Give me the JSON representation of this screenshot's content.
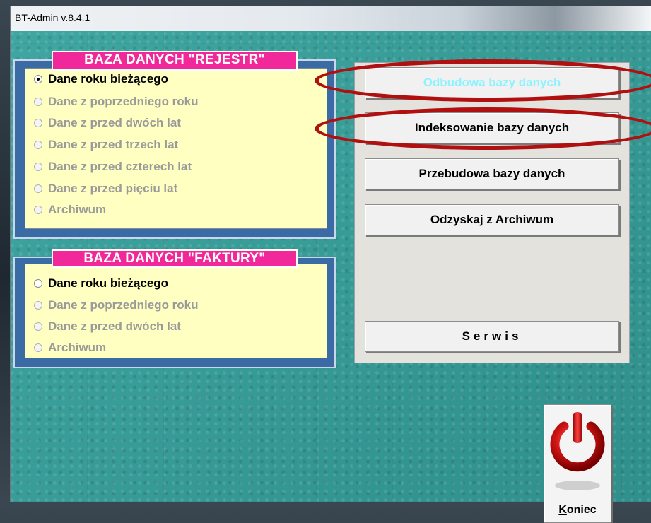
{
  "window": {
    "title": "BT-Admin  v.8.4.1"
  },
  "rejestr": {
    "title": "BAZA DANYCH \"REJESTR\"",
    "options": [
      {
        "label": "Dane roku bieżącego",
        "enabled": true,
        "selected": true
      },
      {
        "label": "Dane z poprzedniego roku",
        "enabled": false,
        "selected": false
      },
      {
        "label": "Dane z przed dwóch lat",
        "enabled": false,
        "selected": false
      },
      {
        "label": "Dane z przed trzech lat",
        "enabled": false,
        "selected": false
      },
      {
        "label": "Dane z przed czterech lat",
        "enabled": false,
        "selected": false
      },
      {
        "label": "Dane z przed pięciu lat",
        "enabled": false,
        "selected": false
      },
      {
        "label": "Archiwum",
        "enabled": false,
        "selected": false
      }
    ]
  },
  "faktury": {
    "title": "BAZA DANYCH \"FAKTURY\"",
    "options": [
      {
        "label": "Dane roku bieżącego",
        "enabled": true,
        "selected": false
      },
      {
        "label": "Dane z poprzedniego roku",
        "enabled": false,
        "selected": false
      },
      {
        "label": "Dane z przed dwóch lat",
        "enabled": false,
        "selected": false
      },
      {
        "label": "Archiwum",
        "enabled": false,
        "selected": false
      }
    ]
  },
  "actions": {
    "odbudowa": "Odbudowa bazy danych",
    "indeksowanie": "Indeksowanie bazy danych",
    "przebudowa": "Przebudowa bazy danych",
    "odzyskaj": "Odzyskaj z Archiwum",
    "serwis": "Serwis"
  },
  "exit": {
    "label_hotkey": "K",
    "label_rest": "oniec",
    "icon": "power-icon"
  },
  "colors": {
    "client_bg": "#3a9b97",
    "group_frame": "#3b6ba5",
    "group_title": "#f0289a",
    "list_bg": "#ffffc2",
    "highlight_ellipse": "#b01010",
    "disabled_button_text": "#8ff2ff"
  }
}
